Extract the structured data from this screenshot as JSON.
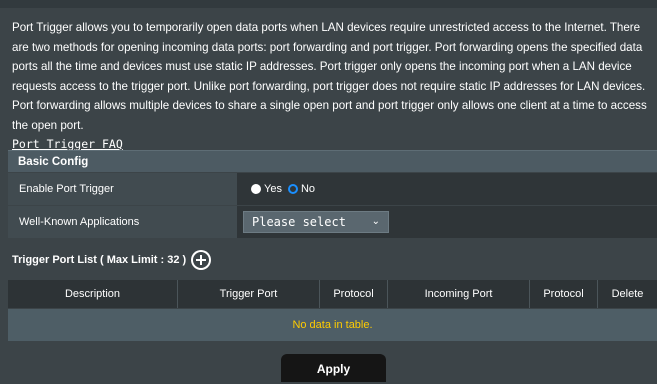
{
  "description": {
    "text": "Port Trigger allows you to temporarily open data ports when LAN devices require unrestricted access to the Internet. There are two methods for opening incoming data ports: port forwarding and port trigger. Port forwarding opens the specified data ports all the time and devices must use static IP addresses. Port trigger only opens the incoming port when a LAN device requests access to the trigger port. Unlike port forwarding, port trigger does not require static IP addresses for LAN devices. Port forwarding allows multiple devices to share a single open port and port trigger only allows one client at a time to access the open port.",
    "faq_link": "Port Trigger FAQ"
  },
  "basic_config": {
    "title": "Basic Config",
    "enable_label": "Enable Port Trigger",
    "enable_options": {
      "yes": "Yes",
      "no": "No",
      "selected": "No"
    },
    "apps_label": "Well-Known Applications",
    "apps_select_value": "Please select"
  },
  "trigger_list": {
    "title": "Trigger Port List ( Max Limit : 32 )",
    "columns": [
      "Description",
      "Trigger Port",
      "Protocol",
      "Incoming Port",
      "Protocol",
      "Delete"
    ],
    "empty_message": "No data in table."
  },
  "apply_label": "Apply",
  "colors": {
    "accent_radio": "#1a8fff",
    "empty_text": "#ffcc00",
    "background": "#3c4448"
  }
}
